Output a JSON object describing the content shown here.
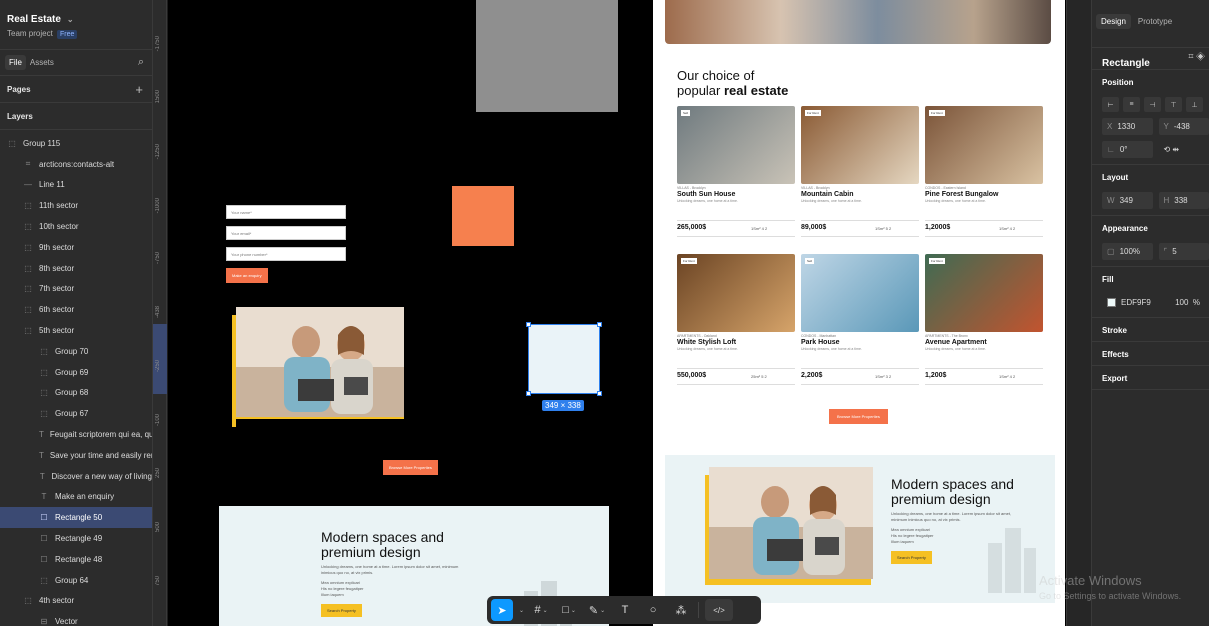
{
  "project": {
    "title": "Real Estate",
    "subtitle": "Team project",
    "plan": "Free"
  },
  "left_tabs": {
    "file": "File",
    "assets": "Assets"
  },
  "sections": {
    "pages": "Pages",
    "layers": "Layers"
  },
  "layers": [
    {
      "label": "Group 115",
      "icon": "frame",
      "indent": 0
    },
    {
      "label": "arcticons:contacts-alt",
      "icon": "grid",
      "indent": 1
    },
    {
      "label": "Line 11",
      "icon": "line",
      "indent": 1
    },
    {
      "label": "11th sector",
      "icon": "frame",
      "indent": 1
    },
    {
      "label": "10th sector",
      "icon": "frame",
      "indent": 1
    },
    {
      "label": "9th sector",
      "icon": "frame",
      "indent": 1
    },
    {
      "label": "8th sector",
      "icon": "frame",
      "indent": 1
    },
    {
      "label": "7th sector",
      "icon": "frame",
      "indent": 1
    },
    {
      "label": "6th sector",
      "icon": "frame",
      "indent": 1
    },
    {
      "label": "5th sector",
      "icon": "frame",
      "indent": 1
    },
    {
      "label": "Group 70",
      "icon": "frame",
      "indent": 2
    },
    {
      "label": "Group 69",
      "icon": "frame",
      "indent": 2
    },
    {
      "label": "Group 68",
      "icon": "frame",
      "indent": 2
    },
    {
      "label": "Group 67",
      "icon": "frame",
      "indent": 2
    },
    {
      "label": "Feugait scriptorem qui ea, qu",
      "icon": "text",
      "indent": 2
    },
    {
      "label": "Save your time and easily rer",
      "icon": "text",
      "indent": 2
    },
    {
      "label": "Discover a new way of living",
      "icon": "text",
      "indent": 2
    },
    {
      "label": "Make an enquiry",
      "icon": "text",
      "indent": 2
    },
    {
      "label": "Rectangle 50",
      "icon": "rect",
      "indent": 2,
      "selected": true
    },
    {
      "label": "Rectangle 49",
      "icon": "rect",
      "indent": 2
    },
    {
      "label": "Rectangle 48",
      "icon": "rect",
      "indent": 2
    },
    {
      "label": "Group 64",
      "icon": "frame",
      "indent": 2
    },
    {
      "label": "4th sector",
      "icon": "frame",
      "indent": 1
    },
    {
      "label": "Vector",
      "icon": "vector",
      "indent": 2
    }
  ],
  "ruler_ticks": [
    "-1750",
    "1500",
    "-1250",
    "-1000",
    "-750",
    "-438",
    "-250",
    "-100",
    "250",
    "500",
    "750"
  ],
  "canvas": {
    "form": {
      "name_placeholder": "Your name*",
      "email_placeholder": "Your email*",
      "phone_placeholder": "Your phone number*",
      "button": "Make an enquiry"
    },
    "dimension_badge": "349 × 338",
    "browse_button": "Browse More Properties",
    "modern": {
      "title": "Modern spaces and premium design",
      "body": "Unlocking dreams, one home at a time. Lorem ipsum dolor sit amet, minimum inimicus quo no, at vix primis.",
      "bullets": [
        "Mea omnium explicari",
        "His no legere feugaitper",
        "Illum iaquem"
      ],
      "button": "Search Property"
    },
    "site": {
      "title_line1": "Our choice of",
      "title_line2_plain": "popular ",
      "title_line2_bold": "real estate",
      "properties": [
        {
          "tag": "Sell",
          "location": "VILLAS - Brooklyn",
          "name": "South Sun House",
          "desc": "Unlocking dreams, one home at a time.",
          "price": "265,000$",
          "meta": "1Sm² 4 2",
          "colors": [
            "#6f7a7f",
            "#c9c3b7"
          ]
        },
        {
          "tag": "For Rent",
          "location": "VILLAS - Brooklyn",
          "name": "Mountain  Cabin",
          "desc": "Unlocking dreams, one home at a time.",
          "price": "89,000$",
          "meta": "1Sm² 5 2",
          "colors": [
            "#8a5a34",
            "#e5d7c1"
          ]
        },
        {
          "tag": "For Rent",
          "location": "CONDOS - Eastern Island",
          "name": "Pine Forest Bungalow",
          "desc": "Unlocking dreams, one home at a time.",
          "price": "1,2000$",
          "meta": "1Sm² 4 2",
          "colors": [
            "#7b5439",
            "#d9c2a2"
          ]
        },
        {
          "tag": "For Rent",
          "location": "APARTMENTS - Oakland",
          "name": "White Stylish Loft",
          "desc": "Unlocking dreams, one home at a time.",
          "price": "550,000$",
          "meta": "25m² 5 2",
          "colors": [
            "#6b4424",
            "#d6a46a"
          ]
        },
        {
          "tag": "Sell",
          "location": "CONDOS - Manhattan",
          "name": "Park House",
          "desc": "Unlocking dreams, one home at a time.",
          "price": "2,200$",
          "meta": "1Sm² 3 2",
          "colors": [
            "#bfd6e6",
            "#5a98b8"
          ]
        },
        {
          "tag": "For Rent",
          "location": "APARTMENTS - The Bronx",
          "name": "Avenue Apartment",
          "desc": "Unlocking dreams, one home at a time.",
          "price": "1,200$",
          "meta": "1Sm² 4 2",
          "colors": [
            "#3f6b53",
            "#c2542f"
          ]
        }
      ],
      "browse_button": "Browse More Properties",
      "modern": {
        "title": "Modern spaces and premium design",
        "body": "Unlocking dreams, one home at a time. Lorem ipsum dolor sit amet, minimum inimicus quo no, at vix primis.",
        "bullets": [
          "Mea omnium explicari",
          "His no legere feugaitper",
          "Illum iaquem"
        ],
        "button": "Search Property"
      }
    }
  },
  "toolbar": [
    "move-tool",
    "frame-tool",
    "shape-tool",
    "pen-tool",
    "text-tool",
    "comment-tool",
    "actions-tool",
    "dev-mode-toggle"
  ],
  "right": {
    "tabs": {
      "design": "Design",
      "prototype": "Prototype"
    },
    "element_type": "Rectangle",
    "position": {
      "title": "Position",
      "x_label": "X",
      "x": "1330",
      "y_label": "Y",
      "y": "-438",
      "rotation": "0°"
    },
    "layout": {
      "title": "Layout",
      "w_label": "W",
      "w": "349",
      "h_label": "H",
      "h": "338"
    },
    "appearance": {
      "title": "Appearance",
      "opacity": "100%",
      "radius": "5"
    },
    "fill": {
      "title": "Fill",
      "hex": "EDF9F9",
      "opacity": "100",
      "unit": "%"
    },
    "stroke": "Stroke",
    "effects": "Effects",
    "export": "Export"
  },
  "watermark": {
    "line1": "Activate Windows",
    "line2": "Go to Settings to activate Windows."
  },
  "colors": {
    "accent": "#0d99ff",
    "selection": "#2f80ed",
    "orange": "#f4724a",
    "yellow": "#f5c023",
    "fill": "#EDF9F9"
  }
}
